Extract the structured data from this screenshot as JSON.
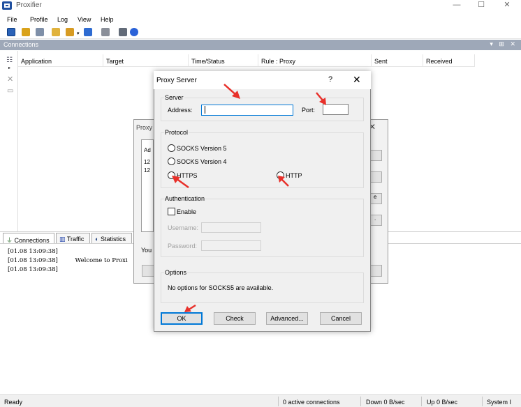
{
  "window": {
    "title": "Proxifier",
    "controls": {
      "minimize": "—",
      "maximize": "☐",
      "close": "✕"
    }
  },
  "menu": [
    "File",
    "Profile",
    "Log",
    "View",
    "Help"
  ],
  "toolbar_icons": [
    "profile-icon",
    "proxies-icon",
    "rules-icon",
    "open-icon",
    "save-icon",
    "dropdown-icon",
    "export-icon",
    "print-icon",
    "help-icon"
  ],
  "connections": {
    "title": "Connections",
    "controls": "▾ ⊞ ✕",
    "columns": [
      "Application",
      "Target",
      "Time/Status",
      "Rule : Proxy",
      "Sent",
      "Received"
    ]
  },
  "tabs": [
    "Connections",
    "Traffic",
    "Statistics"
  ],
  "log": {
    "lines": [
      {
        "time": "[01.08 13:09:38]",
        "message": ""
      },
      {
        "time": "[01.08 13:09:38]",
        "message": "Welcome to Proxi"
      },
      {
        "time": "[01.08 13:09:38]",
        "message": ""
      }
    ]
  },
  "status": {
    "ready": "Ready",
    "active": "0 active connections",
    "down": "Down 0 B/sec",
    "up": "Up 0 B/sec",
    "system": "System I"
  },
  "bg_dialog": {
    "title": "Proxy",
    "list_header": "Ad",
    "list_rows": [
      "12",
      "12"
    ],
    "footer_text": "You",
    "buttons": [
      "",
      "",
      "e",
      "."
    ]
  },
  "dialog": {
    "title": "Proxy Server",
    "help": "?",
    "close": "✕",
    "server": {
      "group_label": "Server",
      "address_label": "Address:",
      "address_value": "",
      "port_label": "Port:",
      "port_value": ""
    },
    "protocol": {
      "group_label": "Protocol",
      "options": [
        "SOCKS Version 5",
        "SOCKS Version 4",
        "HTTPS",
        "HTTP"
      ]
    },
    "auth": {
      "group_label": "Authentication",
      "enable_label": "Enable",
      "username_label": "Username:",
      "password_label": "Password:"
    },
    "options": {
      "group_label": "Options",
      "text": "No options for SOCKS5 are available."
    },
    "buttons": {
      "ok": "OK",
      "check": "Check",
      "advanced": "Advanced...",
      "cancel": "Cancel"
    }
  },
  "colors": {
    "accent": "#0078d7",
    "annotation": "#e8302a",
    "pane_header": "#9ea8b8"
  }
}
